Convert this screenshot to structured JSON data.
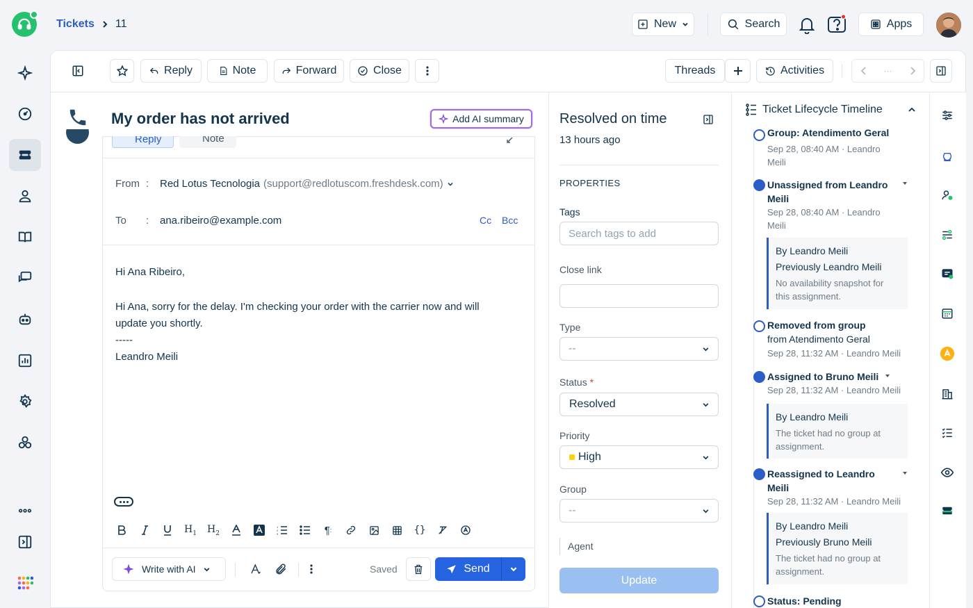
{
  "breadcrumb": {
    "root": "Tickets",
    "separator": ">",
    "id": "11"
  },
  "topbar": {
    "new_label": "New",
    "search_label": "Search",
    "apps_label": "Apps"
  },
  "toolbar": {
    "reply": "Reply",
    "note": "Note",
    "forward": "Forward",
    "close": "Close",
    "threads": "Threads",
    "activities": "Activities"
  },
  "ticket": {
    "subject": "My order has not arrived",
    "ai_summary": "Add AI summary"
  },
  "composer": {
    "tab_reply": "Reply",
    "tab_note": "Note",
    "from_label": "From",
    "from_name": "Red Lotus Tecnologia",
    "from_email": "(support@redlotuscom.freshdesk.com)",
    "to_label": "To",
    "to_value": "ana.ribeiro@example.com",
    "cc": "Cc",
    "bcc": "Bcc",
    "greeting": "Hi Ana Ribeiro,",
    "body_line1": "Hi Ana, sorry for the delay. I'm checking your order with the carrier now and will",
    "body_line2": "update you shortly.",
    "sig_sep": "-----",
    "sig_name": "Leandro Meili",
    "write_ai": "Write with AI",
    "saved": "Saved",
    "send": "Send"
  },
  "properties": {
    "sla_title": "Resolved on time",
    "sla_time": "13 hours ago",
    "heading": "PROPERTIES",
    "tags_label": "Tags",
    "tags_placeholder": "Search tags to add",
    "close_link_label": "Close link",
    "type_label": "Type",
    "type_value": "--",
    "status_label": "Status",
    "status_value": "Resolved",
    "priority_label": "Priority",
    "priority_value": "High",
    "priority_color": "#ffd012",
    "group_label": "Group",
    "group_value": "--",
    "agent_label": "Agent",
    "update": "Update"
  },
  "timeline": {
    "title": "Ticket Lifecycle Timeline",
    "items": [
      {
        "title": "Group: Atendimento Geral",
        "meta1": "Sep 28, 08:40 AM · Leandro",
        "meta2": "Meili"
      },
      {
        "title1": "Unassigned from Leandro",
        "title2": "Meili",
        "meta1": "Sep 28, 08:40 AM · Leandro",
        "meta2": "Meili",
        "box1": "By Leandro Meili",
        "box2": "Previously Leandro Meili",
        "box3": "No availability snapshot for",
        "box4": "this assignment."
      },
      {
        "title1": "Removed from group",
        "title2": "from Atendimento Geral",
        "meta1": "Sep 28, 11:32 AM · Leandro Meili"
      },
      {
        "title1": "Assigned to Bruno Meili",
        "meta1": "Sep 28, 11:32 AM · Leandro Meili",
        "box1": "By Leandro Meili",
        "box3": "The ticket had no group at",
        "box4": "assignment."
      },
      {
        "title1": "Reassigned to Leandro",
        "title2": "Meili",
        "meta1": "Sep 28, 11:32 AM · Leandro Meili",
        "box1": "By Leandro Meili",
        "box2": "Previously Bruno Meili",
        "box3": "The ticket had no group at",
        "box4": "assignment."
      },
      {
        "title1": "Status: Pending"
      }
    ]
  }
}
